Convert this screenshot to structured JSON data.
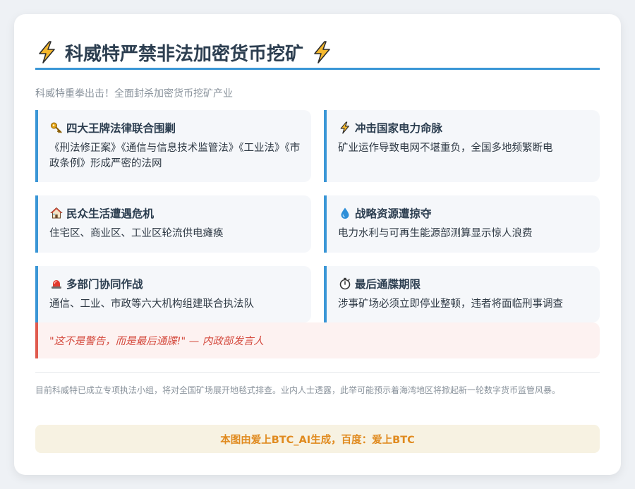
{
  "header": {
    "title": "科威特严禁非法加密货币挖矿",
    "left_icon": "lightning-icon",
    "right_icon": "lightning-icon",
    "accent_color": "#3a96d6"
  },
  "subtitle": "科威特重拳出击！全面封杀加密货币挖矿产业",
  "features": [
    {
      "icon": "key-icon",
      "title": "四大王牌法律联合围剿",
      "desc": "《刑法修正案》《通信与信息技术监管法》《工业法》《市政条例》形成严密的法网"
    },
    {
      "icon": "lightning-icon",
      "title": "冲击国家电力命脉",
      "desc": "矿业运作导致电网不堪重负，全国多地频繁断电"
    },
    {
      "icon": "house-icon",
      "title": "民众生活遭遇危机",
      "desc": "住宅区、商业区、工业区轮流供电瘫痪"
    },
    {
      "icon": "droplet-icon",
      "title": "战略资源遭掠夺",
      "desc": "电力水利与可再生能源部测算显示惊人浪费"
    },
    {
      "icon": "siren-icon",
      "title": "多部门协同作战",
      "desc": "通信、工业、市政等六大机构组建联合执法队"
    },
    {
      "icon": "stopwatch-icon",
      "title": "最后通牒期限",
      "desc": "涉事矿场必须立即停业整顿，违者将面临刑事调查"
    }
  ],
  "quote": "\"这不是警告，而是最后通牒!\" — 内政部发言人",
  "note": "目前科威特已成立专项执法小组，将对全国矿场展开地毯式排查。业内人士透露，此举可能预示着海湾地区将掀起新一轮数字货币监管风暴。",
  "footer": "本图由爱上BTC_AI生成，百度：爱上BTC",
  "colors": {
    "quote_accent": "#e05a4e",
    "footer_text": "#e08a1e",
    "footer_bg": "#f7f2e2"
  }
}
